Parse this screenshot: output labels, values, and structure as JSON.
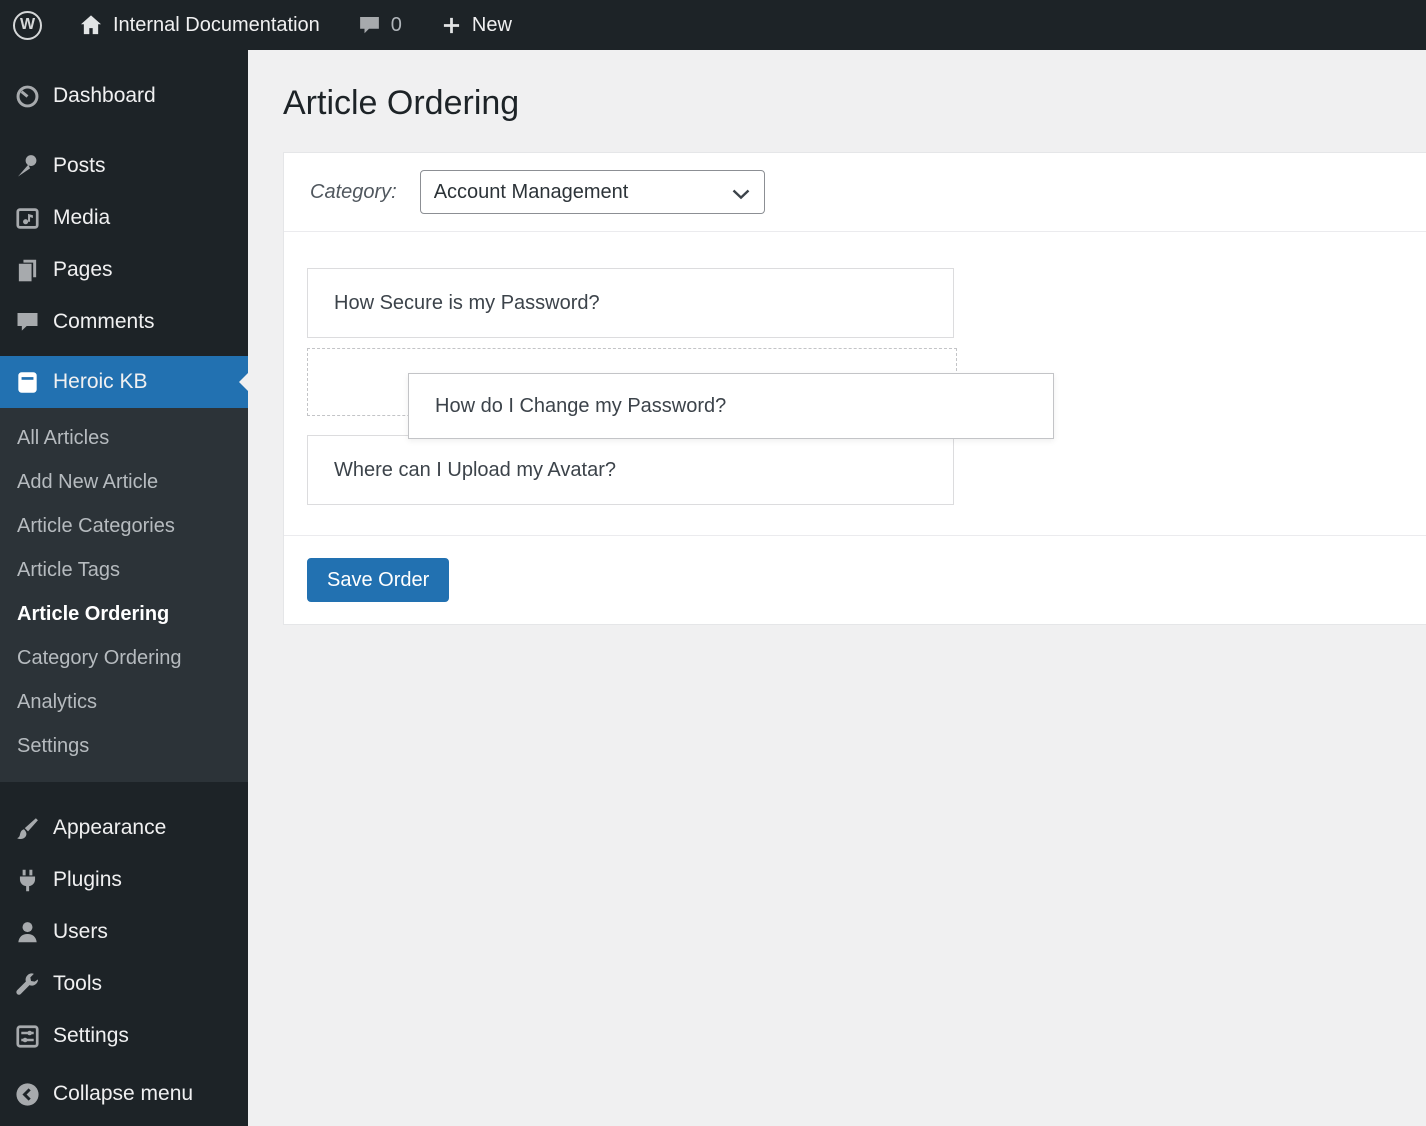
{
  "admin_bar": {
    "wp_logo_letter": "W",
    "site_name": "Internal Documentation",
    "comments_count": "0",
    "new_label": "New"
  },
  "sidebar": {
    "items": [
      {
        "label": "Dashboard",
        "icon": "dashboard-icon"
      },
      {
        "label": "Posts",
        "icon": "pin-icon"
      },
      {
        "label": "Media",
        "icon": "media-icon"
      },
      {
        "label": "Pages",
        "icon": "pages-icon"
      },
      {
        "label": "Comments",
        "icon": "comments-icon"
      },
      {
        "label": "Heroic KB",
        "icon": "book-icon",
        "active": true
      },
      {
        "label": "Appearance",
        "icon": "brush-icon"
      },
      {
        "label": "Plugins",
        "icon": "plug-icon"
      },
      {
        "label": "Users",
        "icon": "user-icon"
      },
      {
        "label": "Tools",
        "icon": "wrench-icon"
      },
      {
        "label": "Settings",
        "icon": "settings-icon"
      }
    ],
    "submenu": {
      "items": [
        {
          "label": "All Articles"
        },
        {
          "label": "Add New Article"
        },
        {
          "label": "Article Categories"
        },
        {
          "label": "Article Tags"
        },
        {
          "label": "Article Ordering",
          "current": true
        },
        {
          "label": "Category Ordering"
        },
        {
          "label": "Analytics"
        },
        {
          "label": "Settings"
        }
      ]
    },
    "collapse_label": "Collapse menu"
  },
  "main": {
    "page_title": "Article Ordering",
    "category": {
      "label": "Category:",
      "selected": "Account Management"
    },
    "list": {
      "item1": "How Secure is my Password?",
      "dragged": "How do I Change my Password?",
      "item3": "Where can I Upload my Avatar?"
    },
    "save_button": "Save Order"
  },
  "colors": {
    "accent": "#2271b1",
    "admin_bar_bg": "#1d2327",
    "submenu_bg": "#2c3338",
    "content_bg": "#f0f0f1"
  }
}
